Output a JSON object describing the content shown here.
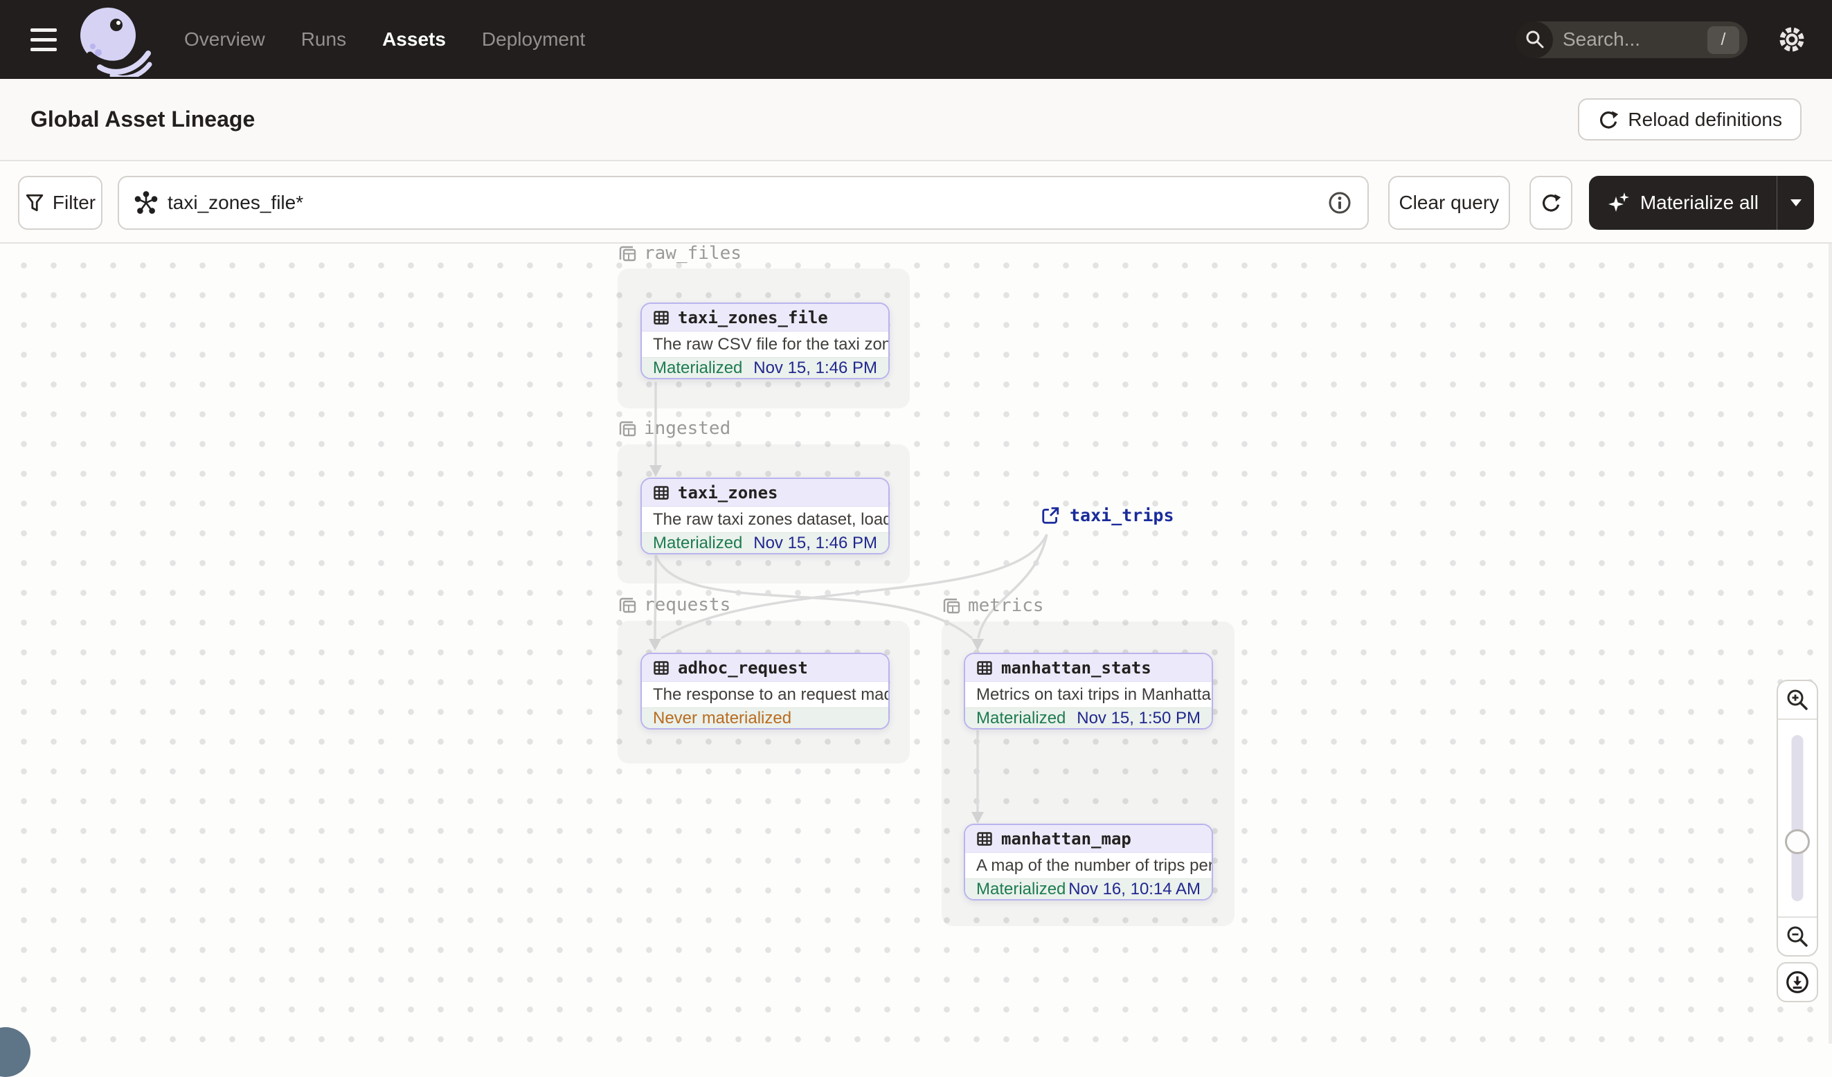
{
  "topbar": {
    "nav_items": [
      {
        "label": "Overview",
        "active": false
      },
      {
        "label": "Runs",
        "active": false
      },
      {
        "label": "Assets",
        "active": true
      },
      {
        "label": "Deployment",
        "active": false
      }
    ],
    "search": {
      "placeholder": "Search...",
      "shortcut": "/"
    }
  },
  "header": {
    "title": "Global Asset Lineage",
    "reload_button": "Reload definitions"
  },
  "toolbar": {
    "filter_button": "Filter",
    "query_input_value": "taxi_zones_file*",
    "clear_query_button": "Clear query",
    "materialize_button": "Materialize all"
  },
  "graph": {
    "groups": [
      {
        "name": "raw_files"
      },
      {
        "name": "ingested"
      },
      {
        "name": "requests"
      },
      {
        "name": "metrics"
      }
    ],
    "nodes": [
      {
        "title": "taxi_zones_file",
        "description": "The raw CSV file for the taxi zones dat...",
        "status": "Materialized",
        "timestamp": "Nov 15, 1:46 PM"
      },
      {
        "title": "taxi_zones",
        "description": "The raw taxi zones dataset, loaded int...",
        "status": "Materialized",
        "timestamp": "Nov 15, 1:46 PM"
      },
      {
        "title": "adhoc_request",
        "description": "The response to an request made in th...",
        "status": "Never materialized",
        "timestamp": ""
      },
      {
        "title": "manhattan_stats",
        "description": "Metrics on taxi trips in Manhattan",
        "status": "Materialized",
        "timestamp": "Nov 15, 1:50 PM"
      },
      {
        "title": "manhattan_map",
        "description": "A map of the number of trips per taxi z...",
        "status": "Materialized",
        "timestamp": "Nov 16, 10:14 AM"
      }
    ],
    "external_asset": {
      "label": "taxi_trips"
    }
  },
  "colors": {
    "node_border_purple": "#B9B3EE",
    "materialized_green": "#1D7C50",
    "never_materialized_orange": "#B96C1F",
    "timestamp_navy": "#20288F",
    "external_link_navy": "#1A2B9B",
    "topbar_bg": "#211E1D"
  }
}
